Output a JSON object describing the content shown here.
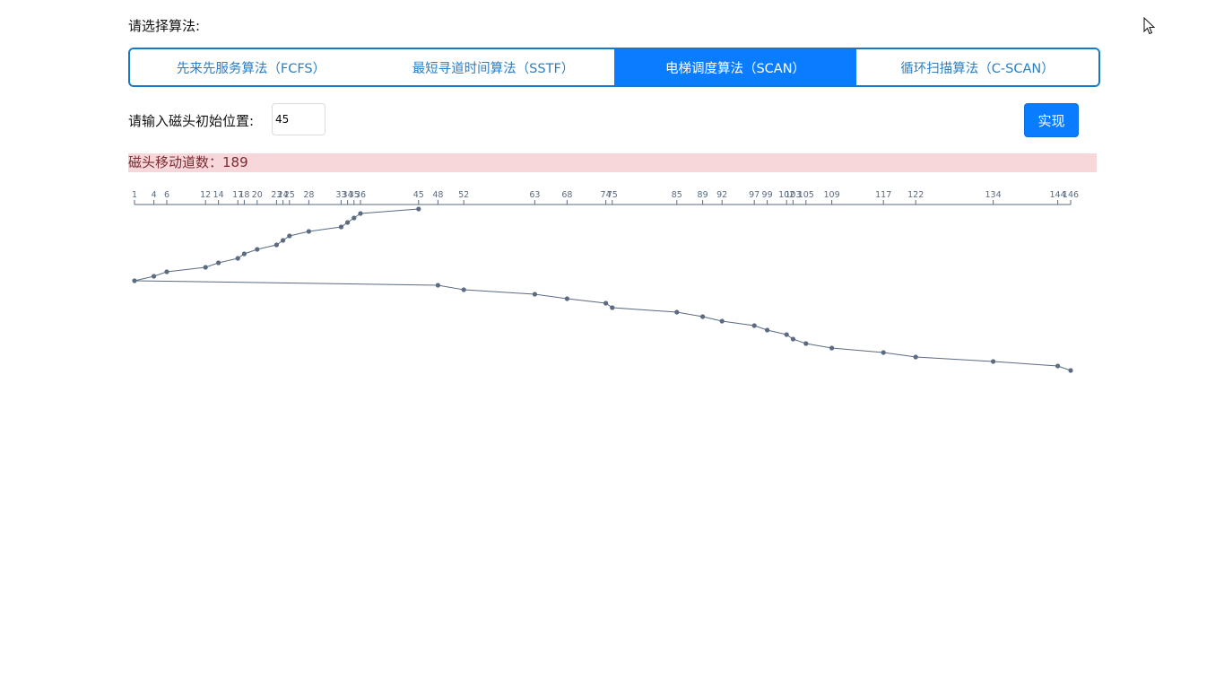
{
  "algorithm_prompt": "请选择算法:",
  "tabs": [
    {
      "label": "先来先服务算法（FCFS）"
    },
    {
      "label": "最短寻道时间算法（SSTF）"
    },
    {
      "label": "电梯调度算法（SCAN）"
    },
    {
      "label": "循环扫描算法（C-SCAN）"
    }
  ],
  "active_tab": 2,
  "position": {
    "label": "请输入磁头初始位置:",
    "value": "45"
  },
  "run_button": "实现",
  "result": {
    "label": "磁头移动道数:",
    "value": "189",
    "text": "磁头移动道数：189"
  },
  "colors": {
    "accent": "#0a7cff",
    "result_bg": "#f7d7da",
    "result_text": "#7a2b31",
    "line": "#5a6b82"
  },
  "chart_data": {
    "type": "line",
    "x_axis_ticks": [
      1,
      4,
      6,
      12,
      14,
      17,
      18,
      20,
      23,
      24,
      25,
      28,
      33,
      34,
      35,
      36,
      45,
      48,
      52,
      63,
      68,
      74,
      75,
      85,
      89,
      92,
      97,
      99,
      102,
      103,
      105,
      109,
      117,
      122,
      134,
      144,
      146
    ],
    "x_range": [
      1,
      146
    ],
    "head_path": [
      45,
      36,
      35,
      34,
      33,
      28,
      25,
      24,
      23,
      20,
      18,
      17,
      14,
      12,
      6,
      4,
      1,
      48,
      52,
      63,
      68,
      74,
      75,
      85,
      89,
      92,
      97,
      99,
      102,
      103,
      105,
      109,
      117,
      122,
      134,
      144,
      146
    ],
    "grid": false
  }
}
